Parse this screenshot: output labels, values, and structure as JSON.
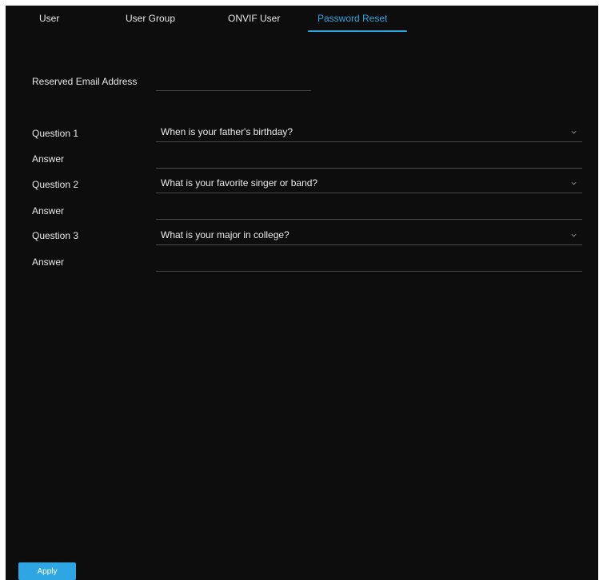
{
  "tabs": [
    {
      "label": "User"
    },
    {
      "label": "User Group"
    },
    {
      "label": "ONVIF User"
    },
    {
      "label": "Password Reset",
      "active": true
    }
  ],
  "form": {
    "email_label": "Reserved Email Address",
    "email_value": "",
    "questions": [
      {
        "label": "Question 1",
        "selected": "When is your father's birthday?",
        "answer_label": "Answer",
        "answer_value": ""
      },
      {
        "label": "Question 2",
        "selected": "What is your favorite singer or band?",
        "answer_label": "Answer",
        "answer_value": ""
      },
      {
        "label": "Question 3",
        "selected": "What is your major in college?",
        "answer_label": "Answer",
        "answer_value": ""
      }
    ]
  },
  "apply_label": "Apply",
  "colors": {
    "accent": "#29a8e0",
    "background": "#0d0d0e",
    "button": "#2ea6e3"
  },
  "icons": {
    "dropdown": "chevron-down-icon"
  }
}
